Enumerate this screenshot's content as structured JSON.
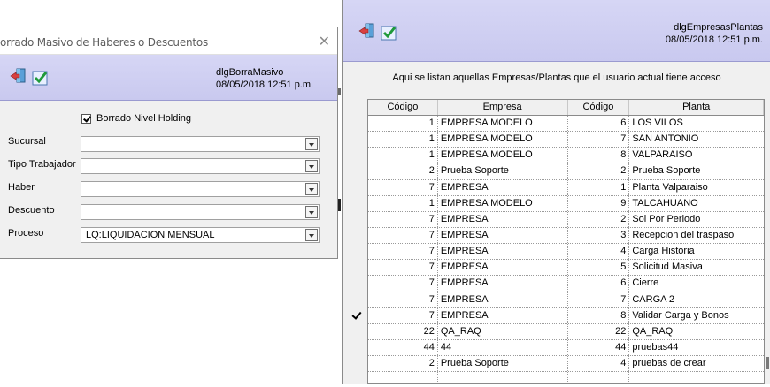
{
  "left_dialog": {
    "title": "orrado Masivo de Haberes o Descuentos",
    "close_glyph": "✕",
    "toolbar": {
      "exit_icon": "exit-door-icon",
      "ok_icon": "checkmark-icon",
      "dialog_name": "dlgBorraMasivo",
      "datetime": "08/05/2018 12:51 p.m."
    },
    "holding_checkbox": {
      "label": "Borrado Nivel Holding",
      "checked": true
    },
    "fields": [
      {
        "label": "Sucursal",
        "value": ""
      },
      {
        "label": "Tipo Trabajador",
        "value": ""
      },
      {
        "label": "Haber",
        "value": ""
      },
      {
        "label": "Descuento",
        "value": ""
      },
      {
        "label": "Proceso",
        "value": "LQ:LIQUIDACION MENSUAL"
      }
    ]
  },
  "right_dialog": {
    "toolbar": {
      "exit_icon": "exit-door-icon",
      "ok_icon": "checkmark-icon",
      "dialog_name": "dlgEmpresasPlantas",
      "datetime": "08/05/2018 12:51 p.m."
    },
    "subtitle": "Aqui se listan aquellas Empresas/Plantas que el usuario actual tiene acceso",
    "grid": {
      "columns": [
        "Código",
        "Empresa",
        "Código",
        "Planta"
      ],
      "rows": [
        [
          "1",
          "EMPRESA MODELO",
          "6",
          "LOS VILOS"
        ],
        [
          "1",
          "EMPRESA MODELO",
          "7",
          "SAN ANTONIO"
        ],
        [
          "1",
          "EMPRESA MODELO",
          "8",
          "VALPARAISO"
        ],
        [
          "2",
          "Prueba Soporte",
          "2",
          "Prueba Soporte"
        ],
        [
          "7",
          "EMPRESA",
          "1",
          "Planta Valparaiso"
        ],
        [
          "1",
          "EMPRESA MODELO",
          "9",
          "TALCAHUANO"
        ],
        [
          "7",
          "EMPRESA",
          "2",
          "Sol Por Periodo"
        ],
        [
          "7",
          "EMPRESA",
          "3",
          "Recepcion del traspaso"
        ],
        [
          "7",
          "EMPRESA",
          "4",
          "Carga Historia"
        ],
        [
          "7",
          "EMPRESA",
          "5",
          "Solicitud Masiva"
        ],
        [
          "7",
          "EMPRESA",
          "6",
          "Cierre"
        ],
        [
          "7",
          "EMPRESA",
          "7",
          "CARGA 2"
        ],
        [
          "7",
          "EMPRESA",
          "8",
          "Validar Carga y Bonos"
        ],
        [
          "22",
          "QA_RAQ",
          "22",
          "QA_RAQ"
        ],
        [
          "44",
          "44",
          "44",
          "pruebas44"
        ],
        [
          "2",
          "Prueba Soporte",
          "4",
          "pruebas de crear"
        ],
        [
          "",
          "",
          "",
          ""
        ]
      ],
      "selected_row_index": 12
    }
  }
}
